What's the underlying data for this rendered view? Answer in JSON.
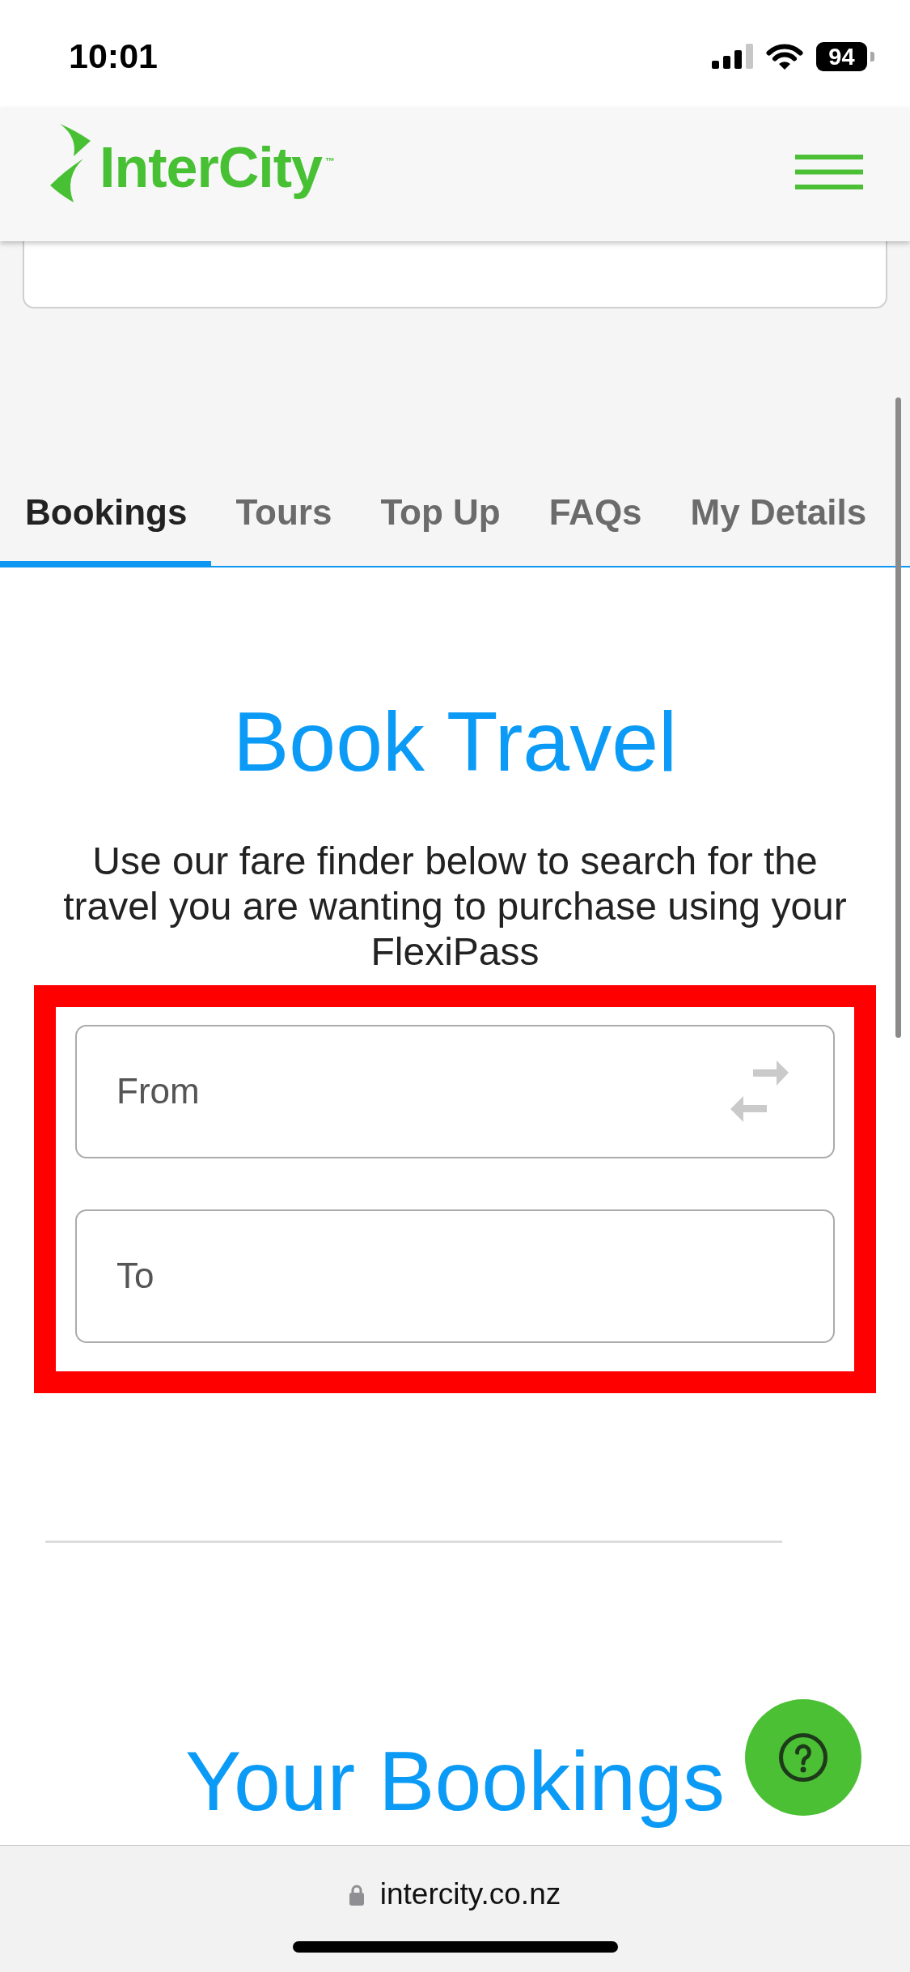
{
  "status_bar": {
    "time": "10:01",
    "battery": "94"
  },
  "header": {
    "logo": "InterCity",
    "trademark": "™"
  },
  "tabs": [
    {
      "label": "Bookings",
      "selected": true
    },
    {
      "label": "Tours",
      "selected": false
    },
    {
      "label": "Top Up",
      "selected": false
    },
    {
      "label": "FAQs",
      "selected": false
    },
    {
      "label": "My Details",
      "selected": false
    }
  ],
  "book_travel": {
    "title": "Book Travel",
    "description": "Use our fare finder below to search for the travel you are wanting to purchase using your FlexiPass",
    "fields": [
      {
        "placeholder": "From",
        "kind": "swap"
      },
      {
        "placeholder": "To",
        "kind": "plain"
      }
    ]
  },
  "your_bookings": {
    "title": "Your Bookings"
  },
  "browser": {
    "url": "intercity.co.nz"
  }
}
